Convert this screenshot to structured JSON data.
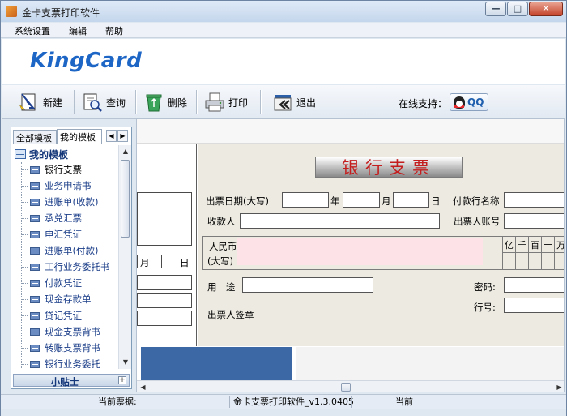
{
  "window": {
    "title": "金卡支票打印软件"
  },
  "menu": [
    "系统设置",
    "编辑",
    "帮助"
  ],
  "banner": {
    "logo": "KingCard"
  },
  "toolbar": {
    "buttons": [
      {
        "label": "新建",
        "icon": "new-document-icon"
      },
      {
        "label": "查询",
        "icon": "search-icon"
      },
      {
        "label": "删除",
        "icon": "recycle-bin-icon"
      },
      {
        "label": "打印",
        "icon": "printer-icon"
      },
      {
        "label": "退出",
        "icon": "exit-icon"
      }
    ],
    "support_label": "在线支持：",
    "qq_label": "QQ"
  },
  "sidebar": {
    "tabs": [
      "全部模板",
      "我的模板"
    ],
    "active_tab": "我的模板",
    "root_label": "我的模板",
    "items": [
      "银行支票",
      "业务申请书",
      "进账单(收款)",
      "承兑汇票",
      "电汇凭证",
      "进账单(付款)",
      "工行业务委托书",
      "付款凭证",
      "现金存款单",
      "贷记凭证",
      "现金支票背书",
      "转账支票背书",
      "银行业务委托"
    ],
    "selected": "银行支票",
    "tips_label": "小贴士",
    "tips_expand": "+"
  },
  "left_strip": {
    "month": "月",
    "day": "日"
  },
  "cheque": {
    "title": "银行支票",
    "issue_date_label": "出票日期(大写)",
    "year": "年",
    "month": "月",
    "day": "日",
    "payer_bank_label": "付款行名称",
    "payee_label": "收款人",
    "payer_account_label": "出票人账号",
    "rmb_label": "人民币",
    "upper_label": "(大写)",
    "digits": [
      "亿",
      "千",
      "百",
      "十",
      "万"
    ],
    "usage_label": "用　途",
    "password_label": "密码:",
    "line_no_label": "行号:",
    "drawer_signature_label": "出票人签章"
  },
  "status": {
    "current_label": "当前票据:",
    "version": "金卡支票打印软件_v1.3.0405",
    "current": "当前"
  }
}
